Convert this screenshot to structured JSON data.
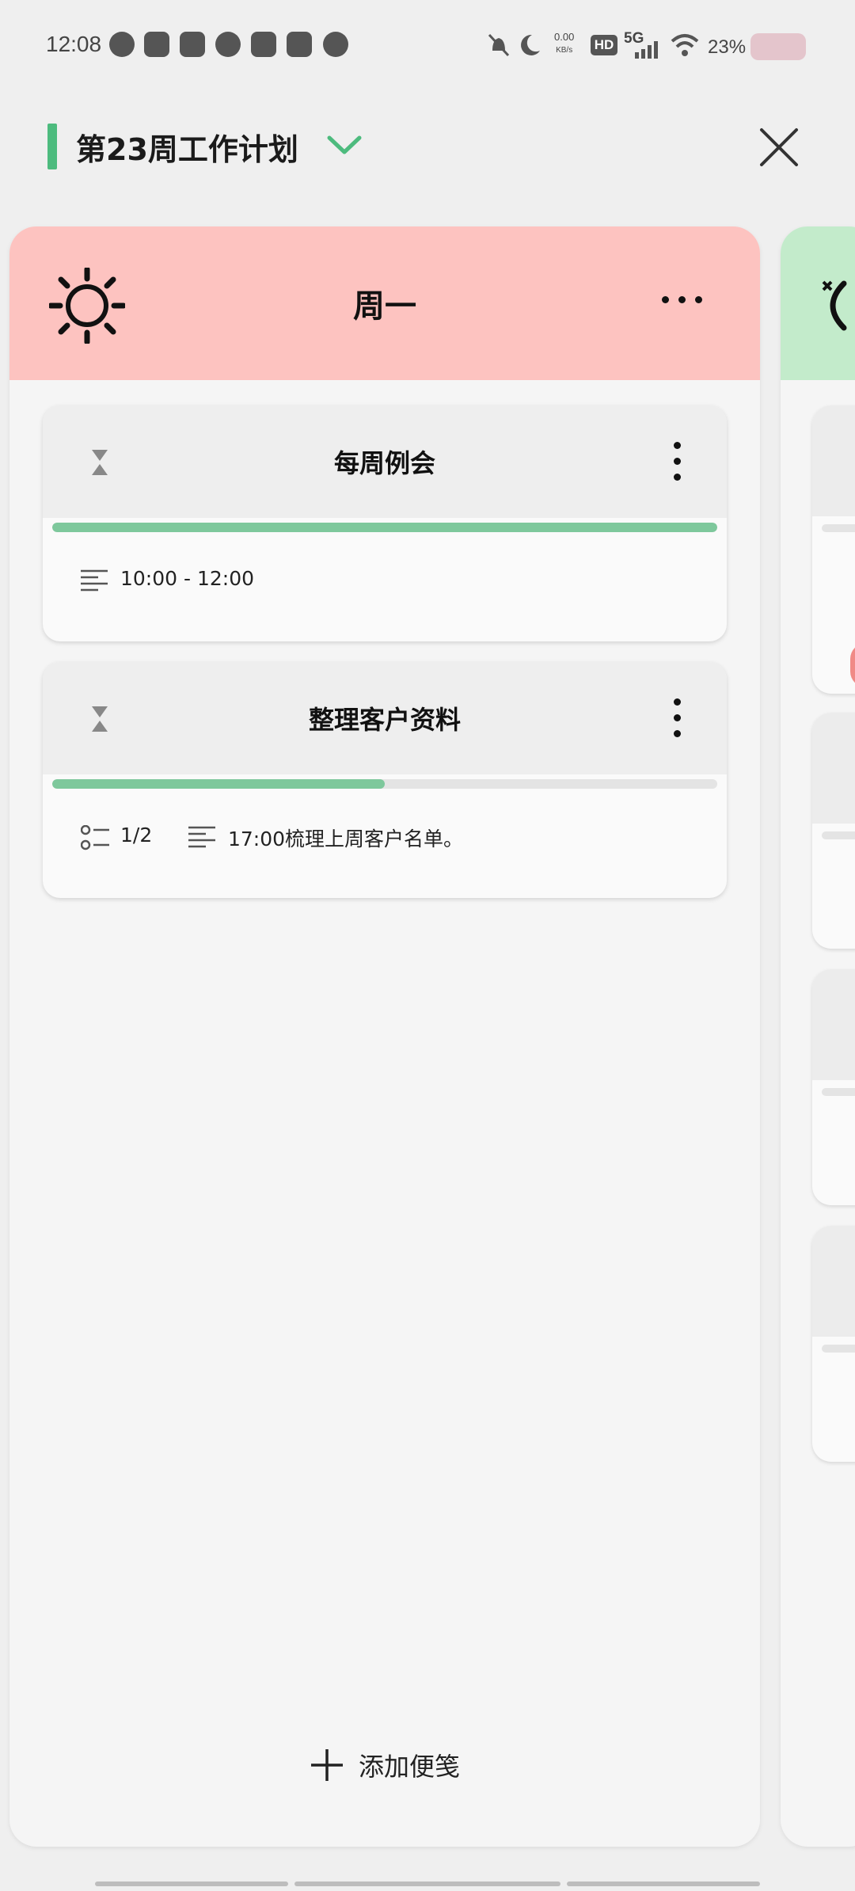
{
  "status_bar": {
    "time": "12:08",
    "speed_value": "0.00",
    "speed_unit": "KB/s",
    "hd": "HD",
    "network": "5G",
    "battery": "23%"
  },
  "header": {
    "title": "第23周工作计划",
    "accent_color": "#4dbb7e"
  },
  "day": {
    "title": "周一",
    "header_color": "#fdc3c0",
    "next_header_color": "#c3ebcb"
  },
  "cards": [
    {
      "title": "每周例会",
      "progress": 1.0,
      "time": "10:00  -  12:00"
    },
    {
      "title": "整理客户资料",
      "progress": 0.5,
      "checklist": "1/2",
      "note": "17:00梳理上周客户名单。"
    }
  ],
  "add_note_label": "添加便笺"
}
